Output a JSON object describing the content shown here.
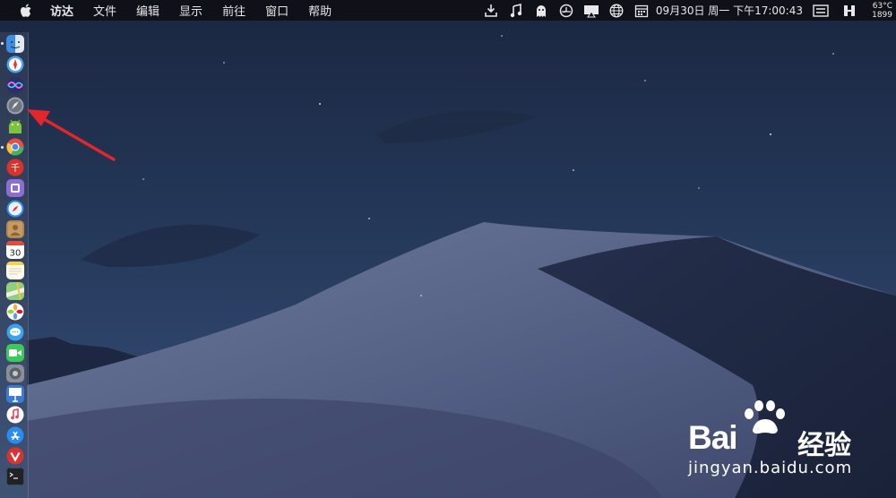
{
  "menubar": {
    "app_name": "访达",
    "menus": [
      "文件",
      "编辑",
      "显示",
      "前往",
      "窗口",
      "帮助"
    ],
    "status_icons": [
      "download-icon",
      "music-note-icon",
      "ghost-icon",
      "time-machine-icon",
      "screen-mirror-icon",
      "globe-icon",
      "calendar-icon"
    ],
    "datetime": "09月30日 周一 下午17:00:43",
    "temperature": "63°C",
    "fan_speed": "1899"
  },
  "dock": {
    "items": [
      "finder-icon",
      "safari-browser-icon",
      "siri-icon",
      "launchpad-rocket-icon",
      "android-icon",
      "chrome-icon",
      "red-app-icon",
      "purple-app-icon",
      "safari-icon",
      "contacts-icon",
      "calendar-icon",
      "notes-icon",
      "maps-icon",
      "photos-icon",
      "messages-icon",
      "facetime-icon",
      "system-preferences-icon",
      "keynote-icon",
      "music-icon",
      "app-store-icon",
      "vivaldi-icon",
      "terminal-icon"
    ],
    "calendar_day": "30"
  },
  "watermark": {
    "brand": "Bai",
    "brand_suffix": "经验",
    "url": "jingyan.baidu.com"
  },
  "colors": {
    "annotation_arrow": "#e3262b",
    "menubar": "#0e1117"
  }
}
